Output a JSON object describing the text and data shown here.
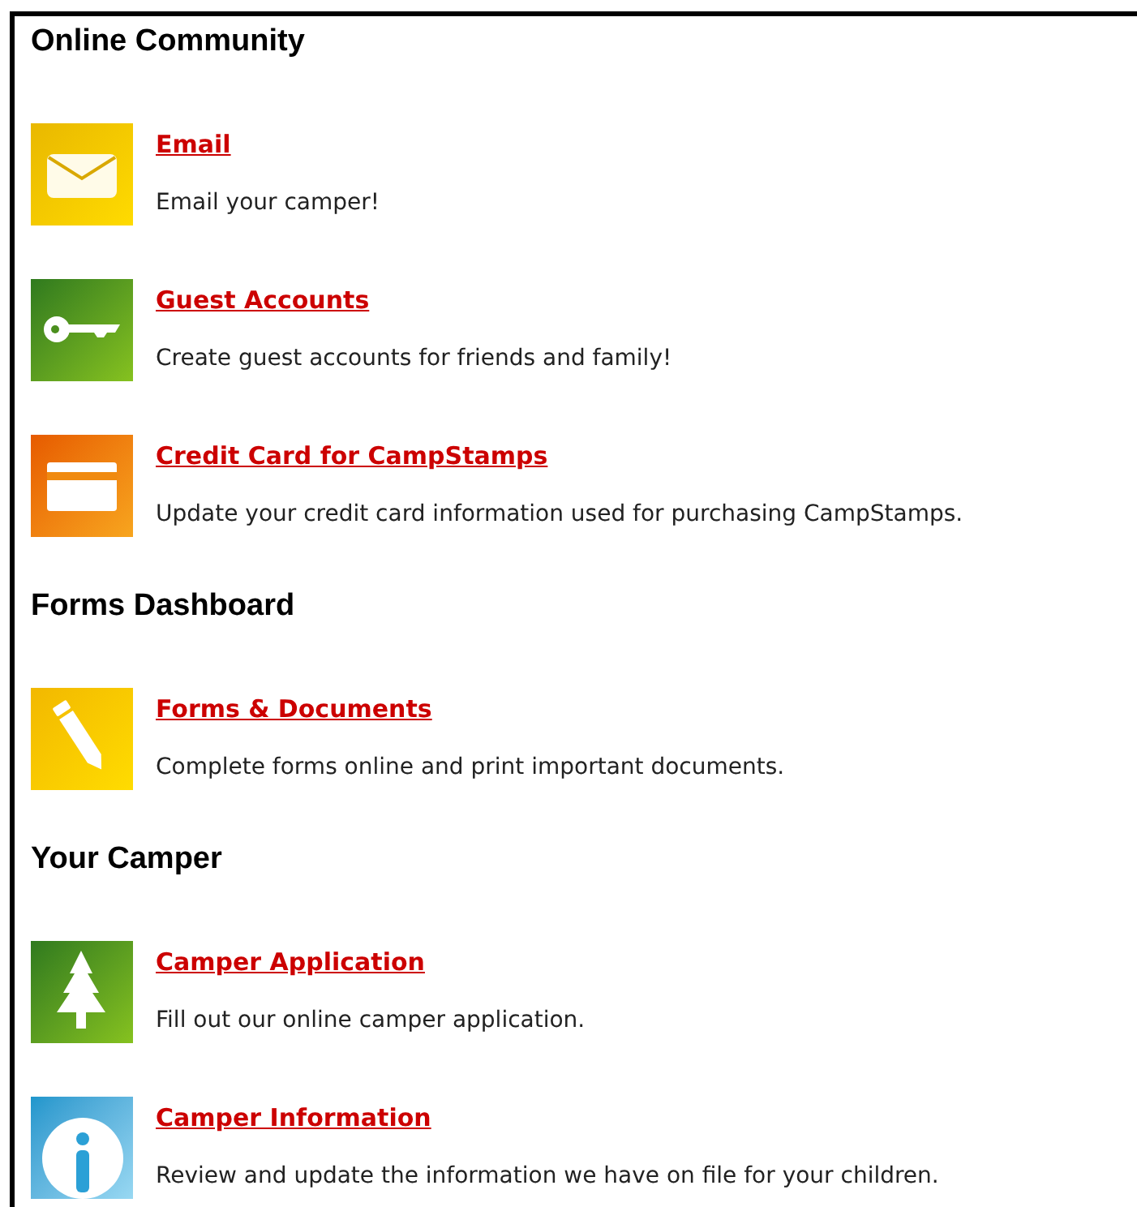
{
  "sections": [
    {
      "heading": "Online Community",
      "items": [
        {
          "kind": "email",
          "title": "Email",
          "description": "Email your camper!"
        },
        {
          "kind": "key",
          "title": "Guest Accounts",
          "description": "Create guest accounts for friends and family!"
        },
        {
          "kind": "card",
          "title": "Credit Card for CampStamps",
          "description": "Update your credit card information used for purchasing CampStamps."
        }
      ]
    },
    {
      "heading": "Forms Dashboard",
      "items": [
        {
          "kind": "pencil",
          "title": "Forms & Documents",
          "description": "Complete forms online and print important documents."
        }
      ]
    },
    {
      "heading": "Your Camper",
      "items": [
        {
          "kind": "tree",
          "title": "Camper Application",
          "description": "Fill out our online camper application."
        },
        {
          "kind": "info",
          "title": "Camper Information",
          "description": "Review and update the information we have on file for your children."
        }
      ]
    }
  ]
}
